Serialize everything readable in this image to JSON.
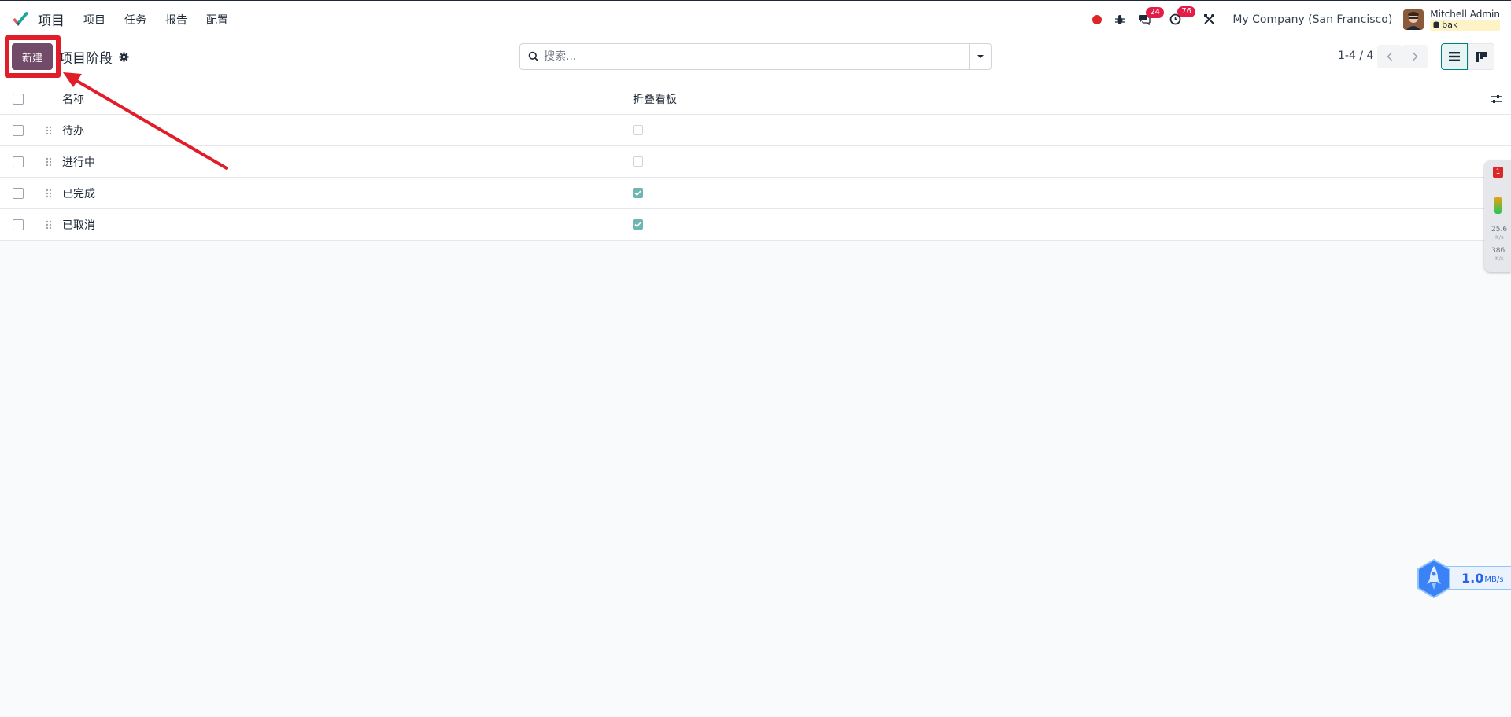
{
  "navbar": {
    "app_name": "项目",
    "menu": [
      {
        "label": "项目"
      },
      {
        "label": "任务"
      },
      {
        "label": "报告"
      },
      {
        "label": "配置"
      }
    ],
    "messages_count": "24",
    "activities_count": "76",
    "company": "My Company (San Francisco)",
    "user_name": "Mitchell Admin",
    "db_name": "bak"
  },
  "control_panel": {
    "new_label": "新建",
    "title": "项目阶段",
    "search_placeholder": "搜索...",
    "pager": "1-4 / 4"
  },
  "table": {
    "columns": {
      "name": "名称",
      "fold": "折叠看板"
    },
    "rows": [
      {
        "name": "待办",
        "folded": false
      },
      {
        "name": "进行中",
        "folded": false
      },
      {
        "name": "已完成",
        "folded": true
      },
      {
        "name": "已取消",
        "folded": true
      }
    ]
  },
  "side_widget": {
    "badge": "1",
    "upload_speed": "25.6",
    "upload_unit": "K/s",
    "download_speed": "386",
    "download_unit": "K/s"
  },
  "speed_widget": {
    "value": "1.0",
    "unit": "MB/s"
  },
  "colors": {
    "brand": "#714b67",
    "annotation": "#e11d2a",
    "check": "#6fb6b3",
    "accent": "#017e84"
  }
}
